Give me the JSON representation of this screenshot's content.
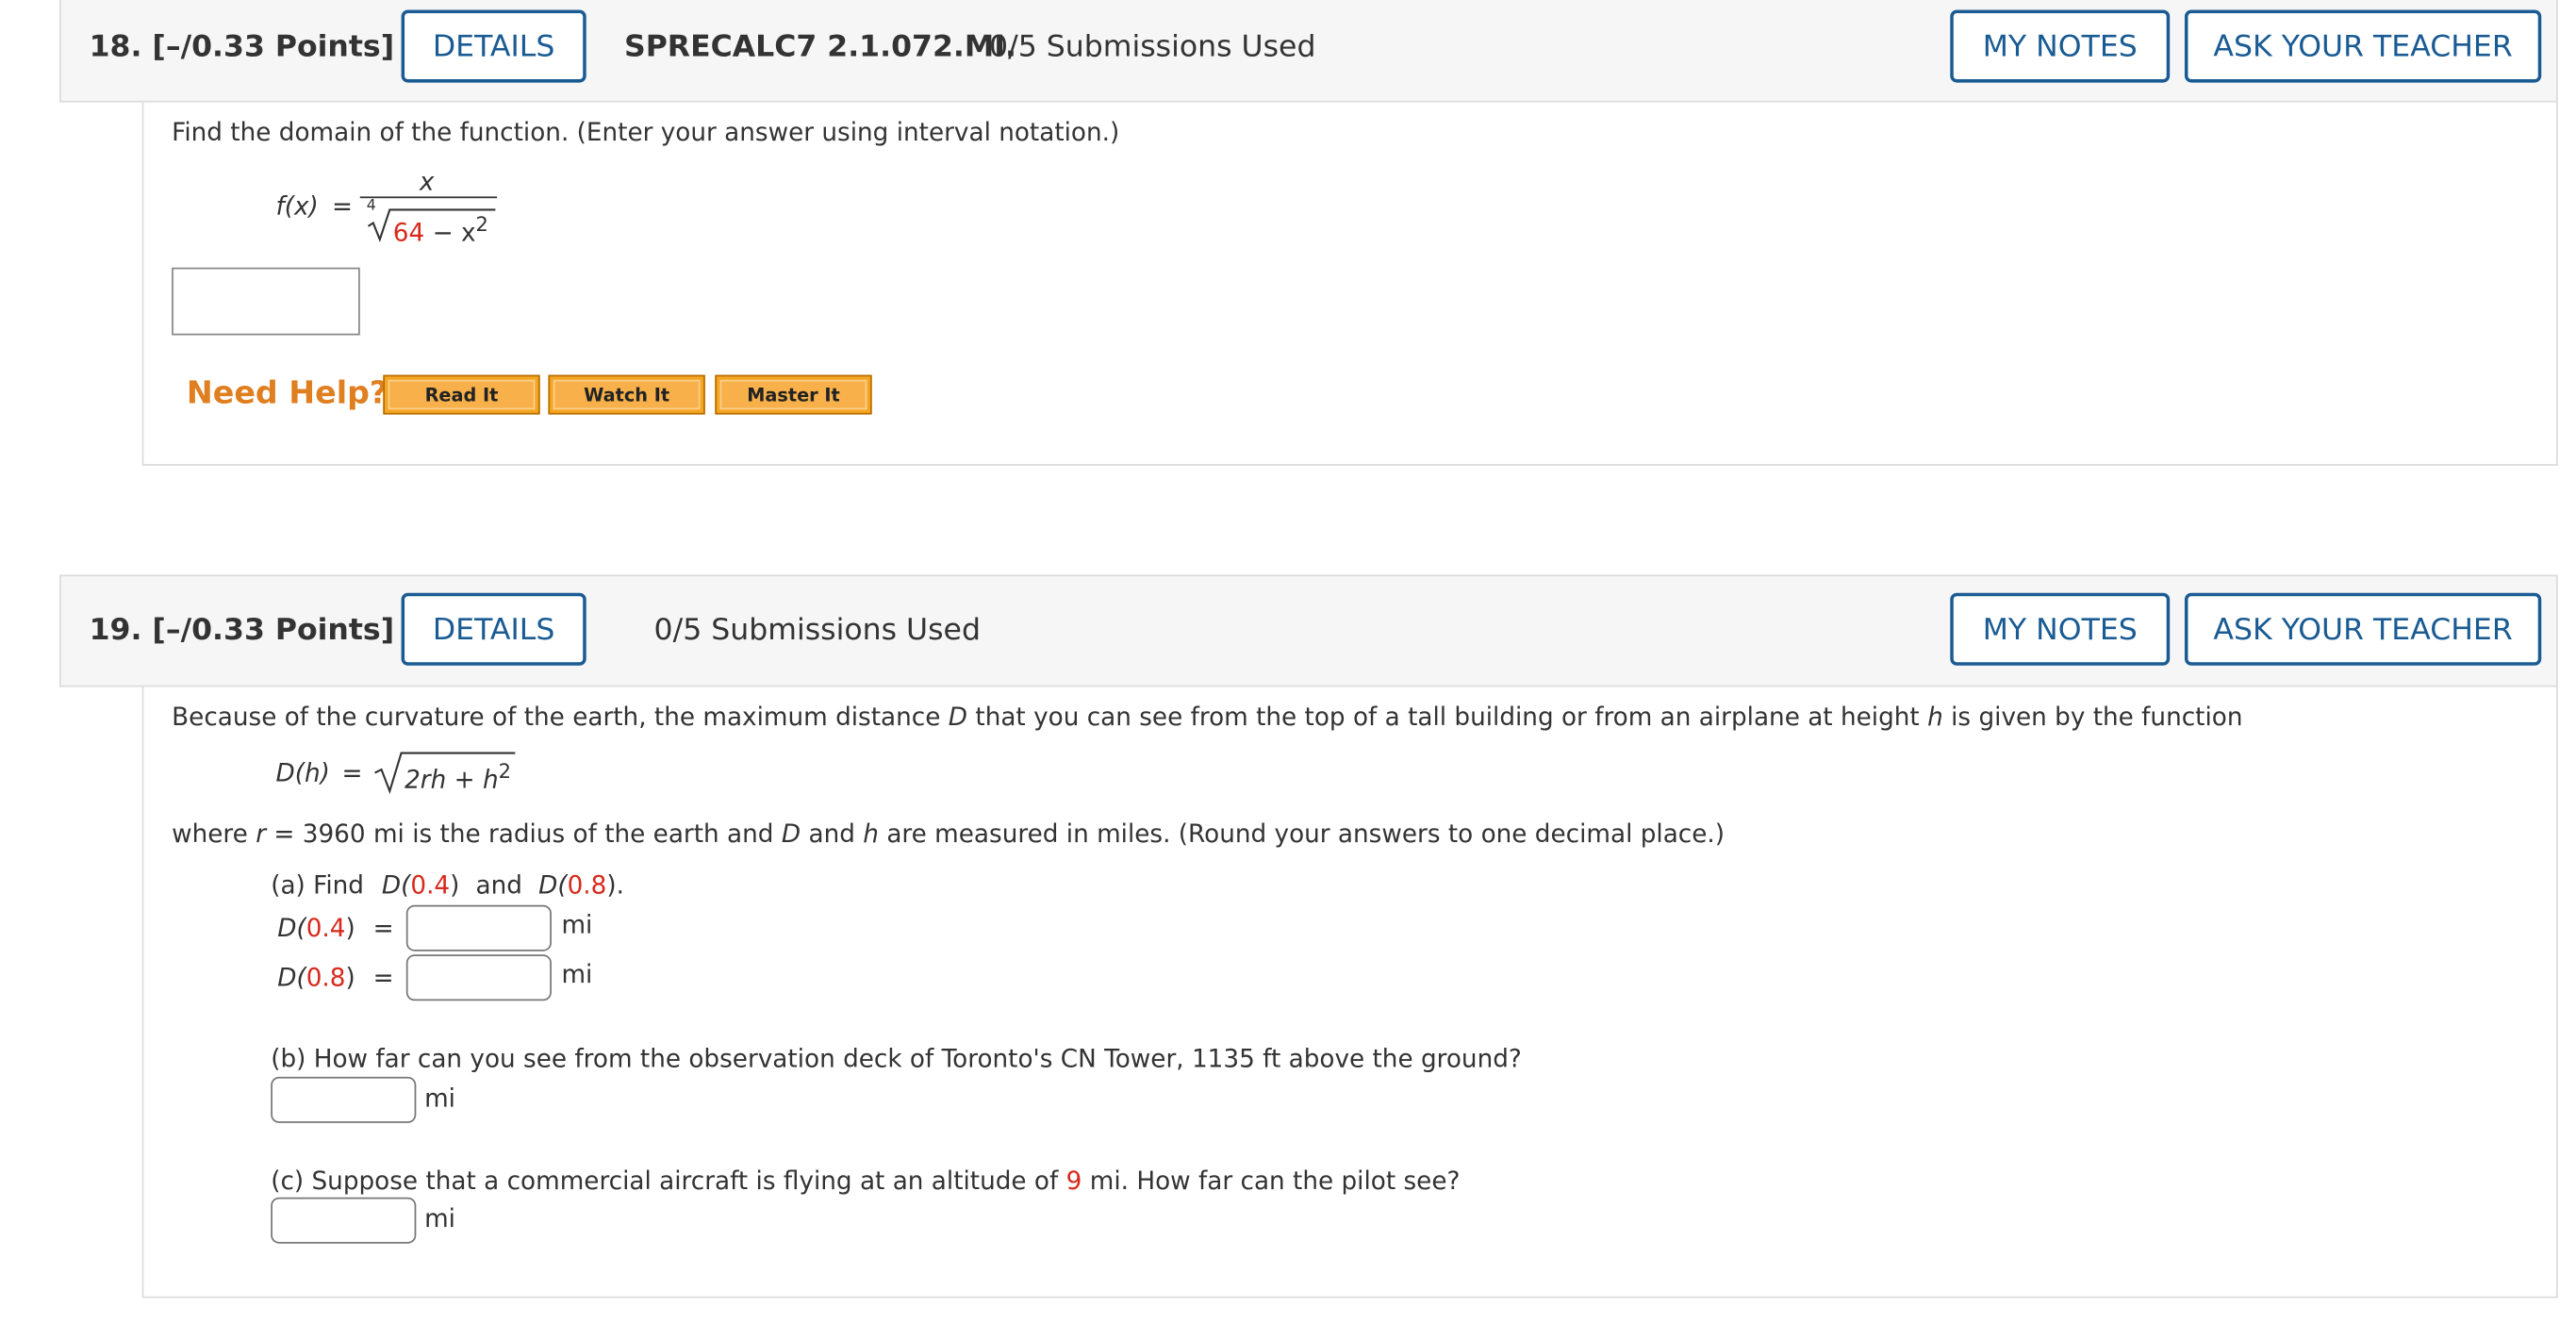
{
  "q18": {
    "number": "18.",
    "points": "[–/0.33 Points]",
    "details_label": "DETAILS",
    "source": "SPRECALC7 2.1.072.MI.",
    "submissions": "0/5 Submissions Used",
    "my_notes_label": "MY NOTES",
    "ask_teacher_label": "ASK YOUR TEACHER",
    "prompt": "Find the domain of the function. (Enter your answer using interval notation.)",
    "fx": "f(x)",
    "equals": "=",
    "numerator": "x",
    "root_index": "4",
    "radicand_const": "64",
    "radicand_rest": "− x",
    "exp": "2",
    "need_help": "Need Help?",
    "help_buttons": [
      "Read It",
      "Watch It",
      "Master It"
    ],
    "colors": {
      "need_help": "#e07f20",
      "highlight": "#d8291c",
      "button_border": "#1a5b93"
    }
  },
  "q19": {
    "number": "19.",
    "points": "[–/0.33 Points]",
    "details_label": "DETAILS",
    "submissions": "0/5 Submissions Used",
    "my_notes_label": "MY NOTES",
    "ask_teacher_label": "ASK YOUR TEACHER",
    "intro": {
      "t1": "Because of the curvature of the earth, the maximum distance",
      "D": "D",
      "t2": "that you can see from the top of a tall building or from an airplane at height",
      "h": "h",
      "t3": "is given by the function"
    },
    "function": {
      "lhs": "D(h)",
      "equals": "=",
      "radicand": "2rh + h",
      "exp": "2"
    },
    "where": {
      "t1": "where",
      "r": "r",
      "t2": "= 3960  mi is the radius of the earth and",
      "D": "D",
      "t3": "and",
      "h": "h",
      "t4": "are measured in miles. (Round your answers to one decimal place.)"
    },
    "part_a": {
      "t1": "(a) Find",
      "d1": "D(",
      "v1": "0.4",
      "c1": ")",
      "and": "and",
      "d2": "D(",
      "v2": "0.8",
      "c2": ").",
      "row1": {
        "pre": "D(",
        "val": "0.4",
        "post": ")",
        "eq": "=",
        "unit": "mi"
      },
      "row2": {
        "pre": "D(",
        "val": "0.8",
        "post": ")",
        "eq": "=",
        "unit": "mi"
      }
    },
    "part_b": {
      "text": "(b) How far can you see from the observation deck of Toronto's CN Tower, 1135 ft above the ground?",
      "unit": "mi"
    },
    "part_c": {
      "t1": "(c) Suppose that a commercial aircraft is flying at an altitude of",
      "val": "9",
      "t2": "mi. How far can the pilot see?",
      "unit": "mi"
    }
  }
}
